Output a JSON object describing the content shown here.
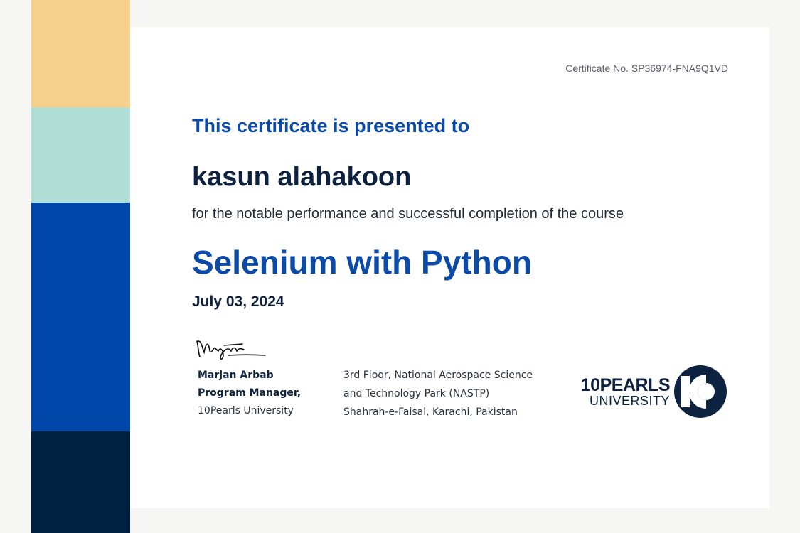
{
  "colors": {
    "stripe_1": "#f6d18d",
    "stripe_2": "#b0ddd4",
    "stripe_3": "#0045a8",
    "stripe_4": "#00203f",
    "accent": "#0b4aa6",
    "navy": "#0d2140"
  },
  "certificate": {
    "number": "Certificate No. SP36974-FNA9Q1VD",
    "heading": "This certificate is presented to",
    "recipient": "kasun alahakoon",
    "reason": "for the notable performance and successful completion of the course",
    "course": "Selenium with Python",
    "date": "July 03, 2024"
  },
  "signer": {
    "signature_icon": "signature-icon",
    "name": "Marjan Arbab",
    "title": "Program Manager,",
    "organization": "10Pearls University"
  },
  "address": {
    "line1": "3rd Floor, National Aerospace Science",
    "line2": "and Technology Park (NASTP)",
    "line3": "Shahrah-e-Faisal, Karachi, Pakistan"
  },
  "logo": {
    "line1": "10PEARLS",
    "line2": "UNIVERSITY",
    "mark_icon": "10-logo-icon"
  }
}
